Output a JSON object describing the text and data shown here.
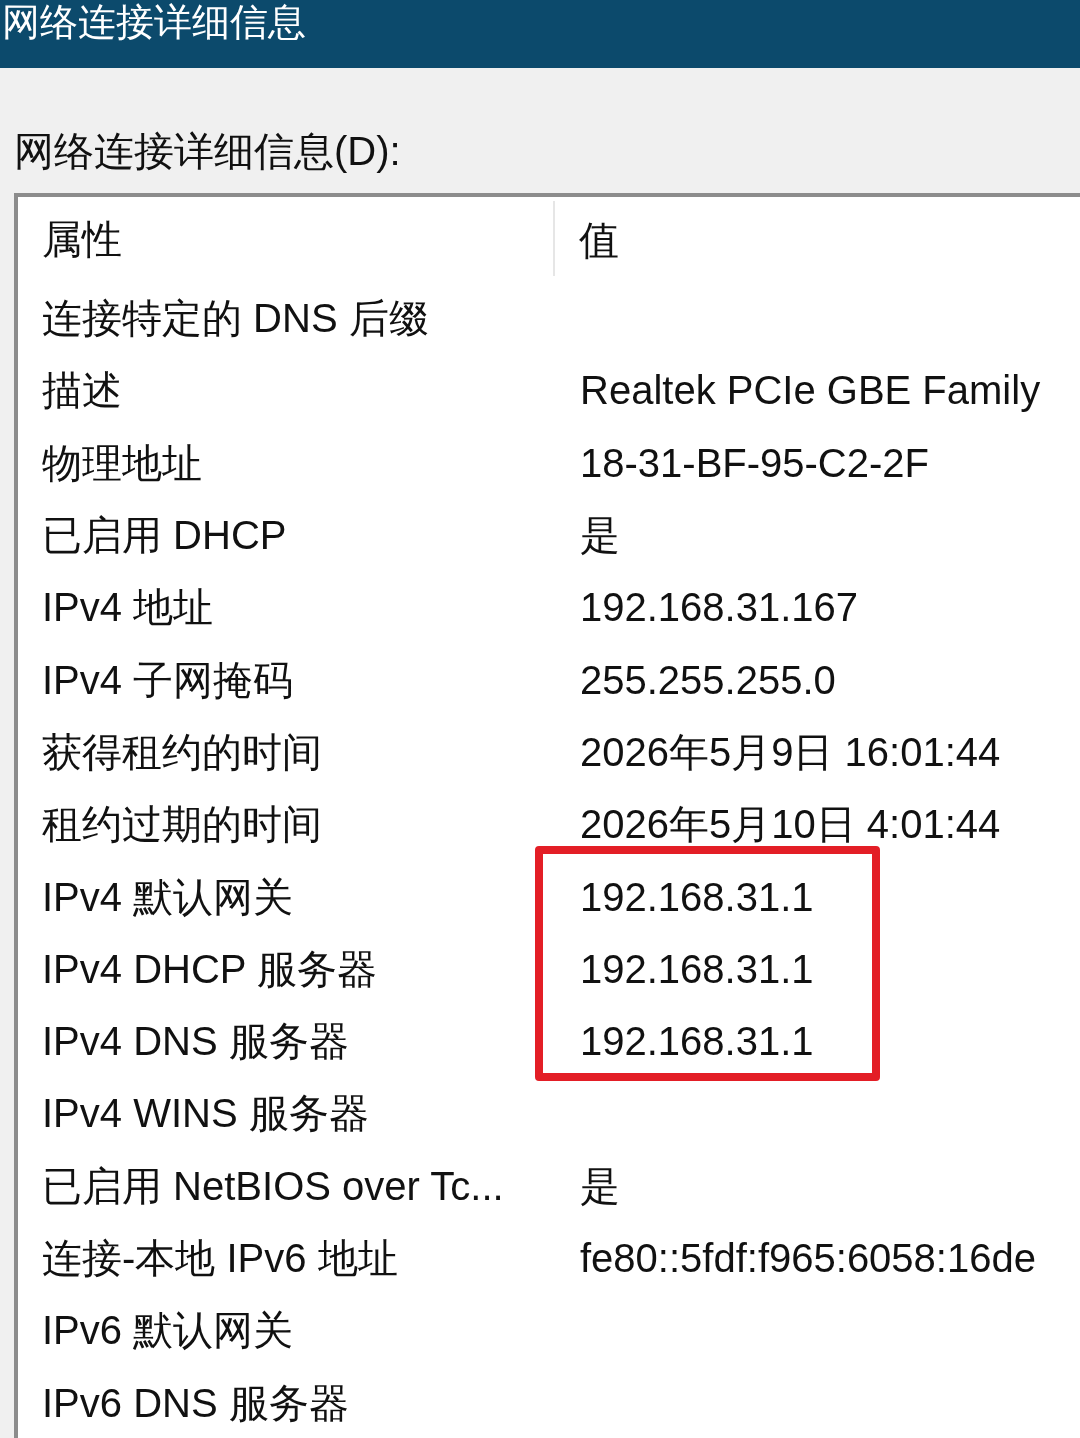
{
  "window": {
    "title": "网络连接详细信息"
  },
  "details_label": "网络连接详细信息(D):",
  "table": {
    "columns": [
      "属性",
      "值"
    ],
    "rows": [
      {
        "property": "连接特定的 DNS 后缀",
        "marked": false
      },
      {
        "property": "描述",
        "value": "Realtek PCIe GBE Family",
        "marked": false
      },
      {
        "property": "物理地址",
        "value": "18-31-BF-95-C2-2F",
        "marked": false
      },
      {
        "property": "已启用 DHCP",
        "value": "是",
        "marked": false
      },
      {
        "property": "IPv4 地址",
        "value": "192.168.31.167",
        "marked": false
      },
      {
        "property": "IPv4 子网掩码",
        "value": "255.255.255.0",
        "marked": false
      },
      {
        "property": "获得租约的时间",
        "value": "2026年5月9日 16:01:44",
        "marked": false
      },
      {
        "property": "租约过期的时间",
        "value": "2026年5月10日 4:01:44",
        "marked": false
      },
      {
        "property": "IPv4 默认网关",
        "value": "192.168.31.1",
        "marked": true
      },
      {
        "property": "IPv4 DHCP 服务器",
        "value": "192.168.31.1",
        "marked": true
      },
      {
        "property": "IPv4 DNS 服务器",
        "value": "192.168.31.1",
        "marked": true
      },
      {
        "property": "IPv4 WINS 服务器",
        "marked": false
      },
      {
        "property": "已启用 NetBIOS over Tc...",
        "value": "是",
        "marked": false
      },
      {
        "property": "连接-本地 IPv6 地址",
        "value": "fe80::5fdf:f965:6058:16de",
        "marked": false
      },
      {
        "property": "IPv6 默认网关",
        "marked": false
      },
      {
        "property": "IPv6 DNS 服务器",
        "marked": false
      }
    ]
  }
}
